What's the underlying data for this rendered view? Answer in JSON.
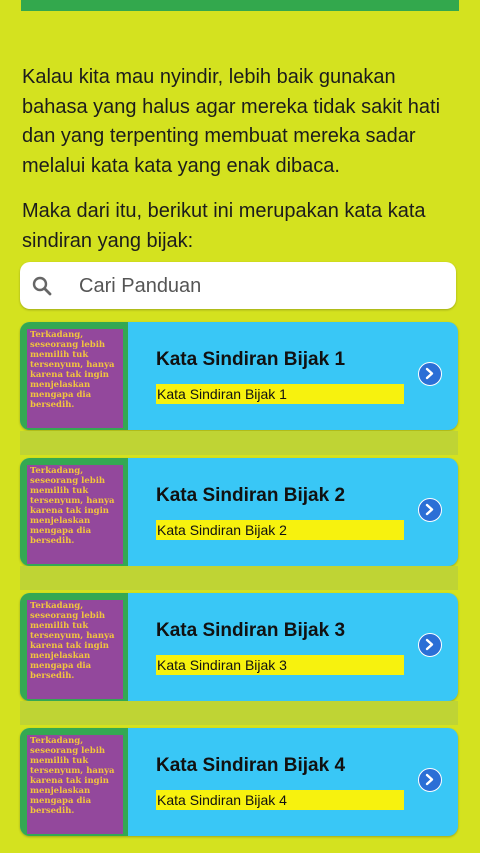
{
  "intro": {
    "paragraph1": "Kalau kita mau nyindir, lebih baik gunakan bahasa yang halus agar mereka tidak sakit hati dan yang terpenting membuat mereka sadar melalui kata kata yang enak dibaca.",
    "paragraph2": "Maka dari itu, berikut ini merupakan kata kata sindiran yang bijak:"
  },
  "search": {
    "placeholder": "Cari Panduan",
    "icon": "search-icon"
  },
  "thumbnail_text": "Terkadang,\nseseorang lebih\nmemilih tuk\ntersenyum, hanya\nkarena tak ingin\nmenjelaskan\nmengapa dia\nbersedih.",
  "items": [
    {
      "title": "Kata Sindiran Bijak 1",
      "subtitle": "Kata Sindiran Bijak 1"
    },
    {
      "title": "Kata Sindiran Bijak 2",
      "subtitle": "Kata Sindiran Bijak 2"
    },
    {
      "title": "Kata Sindiran Bijak 3",
      "subtitle": "Kata Sindiran Bijak 3"
    },
    {
      "title": "Kata Sindiran Bijak 4",
      "subtitle": "Kata Sindiran Bijak 4"
    }
  ],
  "colors": {
    "background": "#d4e21f",
    "card": "#39c7f6",
    "thumbnail_frame": "#34a853",
    "thumbnail_fill": "#93489c",
    "thumbnail_text": "#f2c53d",
    "subtitle_highlight": "#f7f20e",
    "chevron": "#2b6fd6"
  }
}
